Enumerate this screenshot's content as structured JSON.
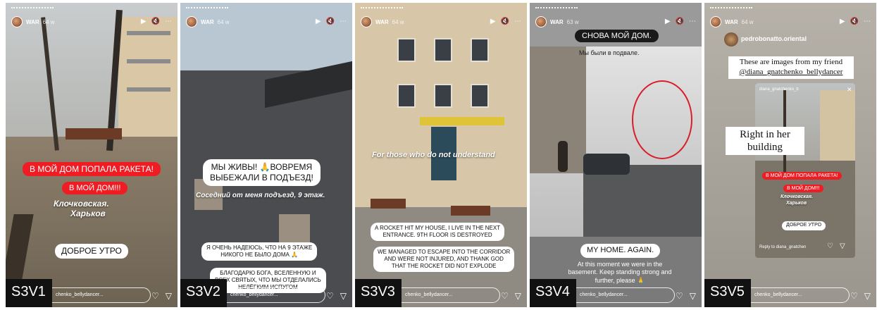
{
  "panels": [
    {
      "tag": "S3V1",
      "header": {
        "username": "WAR",
        "ago": "64 w"
      },
      "stickers": {
        "red1": "В МОЙ ДОМ ПОПАЛА РАКЕТА!",
        "red2": "В МОЙ ДОМ!!!",
        "location_line1": "Клочковская.",
        "location_line2": "Харьков",
        "greeting": "ДОБРОЕ УТРО"
      },
      "reply": "chenko_bellydancer..."
    },
    {
      "tag": "S3V2",
      "header": {
        "username": "WAR",
        "ago": "64 w"
      },
      "stickers": {
        "alive_line1": "МЫ ЖИВЫ! 🙏ВОВРЕМЯ",
        "alive_line2": "ВЫБЕЖАЛИ В ПОДЪЕЗД!",
        "neighbor": "Соседний от меня подъезд, 9 этаж.",
        "hope_line1": "Я ОЧЕНЬ НАДЕЮСЬ, ЧТО НА 9 ЭТАЖЕ",
        "hope_line2": "НИКОГО НЕ БЫЛО ДОМА 🙏",
        "thanks_line1": "БЛАГОДАРЮ БОГА, ВСЕЛЕННУЮ И",
        "thanks_line2": "ВСЕХ СВЯТЫХ, ЧТО МЫ ОТДЕЛАЛИСЬ",
        "thanks_line3": "НЕЛЁГКИМ ИСПУГОМ"
      },
      "reply": "chenko_bellydancer..."
    },
    {
      "tag": "S3V3",
      "header": {
        "username": "WAR",
        "ago": "64 w"
      },
      "stickers": {
        "understand": "For those who do not understand",
        "rocket_line1": "A ROCKET HIT MY HOUSE, I LIVE IN THE NEXT",
        "rocket_line2": "ENTRANCE.  9TH FLOOR IS DESTROYED",
        "escape_line1": "WE MANAGED TO ESCAPE INTO THE CORRIDOR",
        "escape_line2": "AND WERE NOT INJURED, AND THANK GOD",
        "escape_line3": "THAT THE ROCKET DID NOT EXPLODE"
      },
      "reply": "chenko_bellydancer..."
    },
    {
      "tag": "S3V4",
      "header": {
        "username": "WAR",
        "ago": "63 w"
      },
      "stickers": {
        "home_again_ru": "СНОВА МОЙ ДОМ.",
        "basement_ru": "Мы были в подвале.",
        "home_again_en": "MY HOME. AGAIN.",
        "caption_line1": "At this moment we were in the",
        "caption_line2": "basement.  Keep standing strong and",
        "caption_line3": "further, please 🙏"
      },
      "reply": "chenko_bellydancer..."
    },
    {
      "tag": "S3V5",
      "header": {
        "username": "WAR",
        "ago": "64 w"
      },
      "repost": {
        "username": "pedrobonatto.oriental",
        "text_line1": "These are images from my friend",
        "text_line2": "@diana_gnatchenko_bellydancer",
        "right_line1": "Right in her",
        "right_line2": "building",
        "mini_user": "diana_gnatchenko_b",
        "mini_red1": "В МОЙ ДОМ ПОПАЛА РАКЕТА!",
        "mini_red2": "В МОЙ ДОМ!!!",
        "mini_loc1": "Клочковская.",
        "mini_loc2": "Харьков",
        "mini_greeting": "ДОБРОЕ УТРО",
        "mini_reply": "Reply to diana_gnatchen"
      },
      "reply": "chenko_bellydancer..."
    }
  ],
  "icons": {
    "play": "play-icon",
    "mute": "mute-icon",
    "more": "more-icon",
    "heart": "heart-icon",
    "send": "send-icon"
  },
  "colors": {
    "red_sticker": "#ef1c24",
    "tag_bg": "#111111"
  }
}
